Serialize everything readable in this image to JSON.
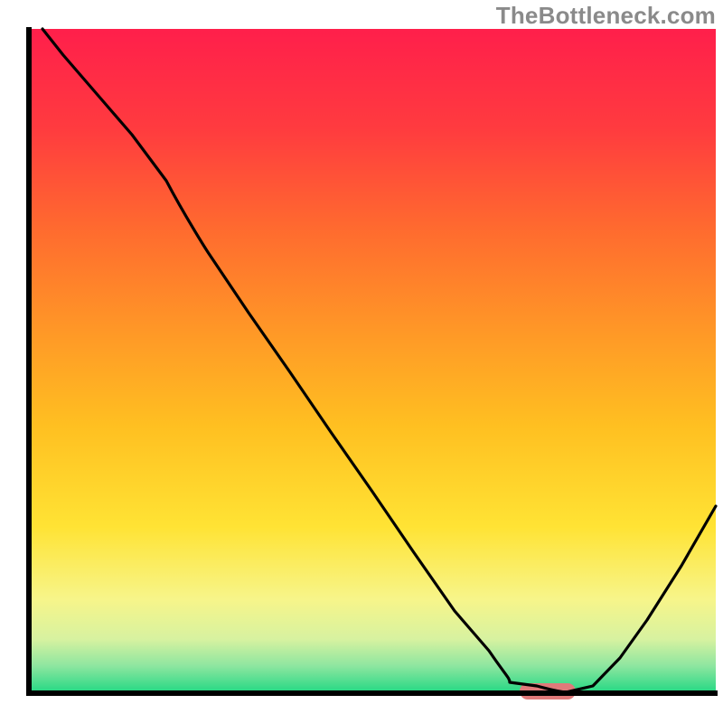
{
  "watermark": "TheBottleneck.com",
  "chart_data": {
    "type": "line",
    "title": "",
    "xlabel": "",
    "ylabel": "",
    "xlim": [
      0,
      100
    ],
    "ylim": [
      0,
      100
    ],
    "grid": false,
    "legend": false,
    "series": [
      {
        "name": "bottleneck-curve",
        "x": [
          2,
          5,
          10,
          15,
          20,
          26,
          32,
          38,
          44,
          50,
          56,
          62,
          67,
          70,
          74,
          78,
          82,
          86,
          90,
          95,
          100
        ],
        "y": [
          100,
          96,
          90,
          84,
          77,
          70,
          61,
          52,
          43,
          34,
          25,
          16,
          8,
          4,
          1,
          0,
          1,
          5,
          11,
          19,
          28
        ],
        "color": "#000000"
      }
    ],
    "marker": {
      "name": "optimal-range",
      "x_start": 72,
      "x_end": 80,
      "y": 0,
      "color": "#e07a7a"
    },
    "background_gradient": {
      "stops": [
        {
          "offset": 0.0,
          "color": "#ff1f4b"
        },
        {
          "offset": 0.15,
          "color": "#ff3b3f"
        },
        {
          "offset": 0.3,
          "color": "#ff6a2f"
        },
        {
          "offset": 0.45,
          "color": "#ff9627"
        },
        {
          "offset": 0.6,
          "color": "#ffc021"
        },
        {
          "offset": 0.75,
          "color": "#ffe334"
        },
        {
          "offset": 0.86,
          "color": "#f7f58a"
        },
        {
          "offset": 0.92,
          "color": "#d7f2a0"
        },
        {
          "offset": 0.96,
          "color": "#8ee6a0"
        },
        {
          "offset": 1.0,
          "color": "#25d884"
        }
      ]
    }
  }
}
